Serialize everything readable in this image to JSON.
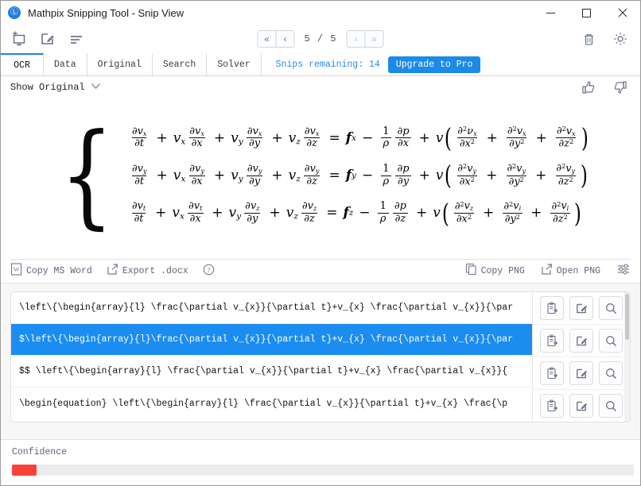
{
  "window": {
    "title": "Mathpix Snipping Tool - Snip View",
    "logo_glyph": "Ⓛ",
    "minimize_label": "–",
    "maximize_label": "□",
    "close_label": "✕"
  },
  "toolbar": {
    "icons": [
      {
        "name": "new-snip-icon",
        "label": "New Snip"
      },
      {
        "name": "edit-snip-icon",
        "label": "Edit Snip"
      },
      {
        "name": "list-view-icon",
        "label": "List"
      }
    ],
    "pager": {
      "first_label": "«",
      "prev_label": "‹",
      "count": "5 / 5",
      "next_label": "›",
      "last_label": "»"
    },
    "right_icons": [
      {
        "name": "trash-icon",
        "label": "Delete"
      },
      {
        "name": "gear-icon",
        "label": "Settings"
      }
    ]
  },
  "tabs": [
    {
      "label": "OCR",
      "active": true
    },
    {
      "label": "Data",
      "active": false
    },
    {
      "label": "Original",
      "active": false
    },
    {
      "label": "Search",
      "active": false
    },
    {
      "label": "Solver",
      "active": false
    }
  ],
  "snips": {
    "remaining_text": "Snips remaining: 14",
    "upgrade_label": "Upgrade to Pro"
  },
  "show_original": {
    "label": "Show Original",
    "caret": "⌄"
  },
  "feedback": {
    "thumbs_up": "thumbs-up-icon",
    "thumbs_down": "thumbs-down-icon"
  },
  "equation": {
    "description": "Navier-Stokes momentum equations rendered from OCR",
    "rows": [
      {
        "lhs_terms": [
          "∂vₓ/∂t",
          "vₓ ∂vₓ/∂x",
          "v_y ∂vₓ/∂y",
          "v_z ∂vₓ/∂z"
        ],
        "rhs": "fₓ - (1/ρ)∂p/∂x + v(∂²νₓ/∂x² + ∂²vₓ/∂y² + ∂²vₓ/∂z²)",
        "var": "x"
      },
      {
        "lhs_terms": [
          "∂v_y/∂t",
          "vₓ ∂v_y/∂x",
          "v_y ∂v_y/∂y",
          "v_z ∂v_y/∂z"
        ],
        "rhs": "f_y - (1/ρ)∂p/∂y + v(∂²v_y/∂x² + ∂²v_y/∂y² + ∂²v_y/∂z²)",
        "var": "y"
      },
      {
        "lhs_terms": [
          "∂v_t/∂t",
          "vₓ ∂v_t/∂x",
          "v_y ∂v_z/∂y",
          "v_z ∂v_z/∂z"
        ],
        "rhs": "f_z - (1/ρ)∂p/∂z + v(∂²v_z/∂x² + ∂²v_i/∂y² + ∂²v_i/∂z²)",
        "var": "z"
      }
    ]
  },
  "action_bar": {
    "left": [
      {
        "name": "copy-ms-word",
        "label": "Copy MS Word",
        "icon": "word-doc-icon"
      },
      {
        "name": "export-docx",
        "label": "Export .docx",
        "icon": "external-link-icon"
      },
      {
        "name": "help",
        "label": "",
        "icon": "question-circle-icon"
      }
    ],
    "right": [
      {
        "name": "copy-png",
        "label": "Copy PNG",
        "icon": "copy-icon"
      },
      {
        "name": "open-png",
        "label": "Open PNG",
        "icon": "external-link-icon"
      },
      {
        "name": "render-settings",
        "label": "",
        "icon": "sliders-icon"
      }
    ]
  },
  "results": {
    "row_icons": [
      {
        "name": "copy-to-clipboard-icon",
        "label": "Copy"
      },
      {
        "name": "edit-icon",
        "label": "Edit"
      },
      {
        "name": "search-icon",
        "label": "Search"
      }
    ],
    "rows": [
      {
        "text": "\\left\\{\\begin{array}{l} \\frac{\\partial v_{x}}{\\partial t}+v_{x} \\frac{\\partial v_{x}}{\\par",
        "selected": false
      },
      {
        "text": "$\\left\\{\\begin{array}{l}\\frac{\\partial v_{x}}{\\partial t}+v_{x} \\frac{\\partial v_{x}}{\\par",
        "selected": true
      },
      {
        "text": "$$  \\left\\{\\begin{array}{l} \\frac{\\partial v_{x}}{\\partial t}+v_{x} \\frac{\\partial v_{x}}{",
        "selected": false
      },
      {
        "text": "\\begin{equation}  \\left\\{\\begin{array}{l} \\frac{\\partial v_{x}}{\\partial t}+v_{x} \\frac{\\p",
        "selected": false
      }
    ]
  },
  "confidence": {
    "label": "Confidence",
    "percent": 4,
    "color": "#f9423a"
  }
}
